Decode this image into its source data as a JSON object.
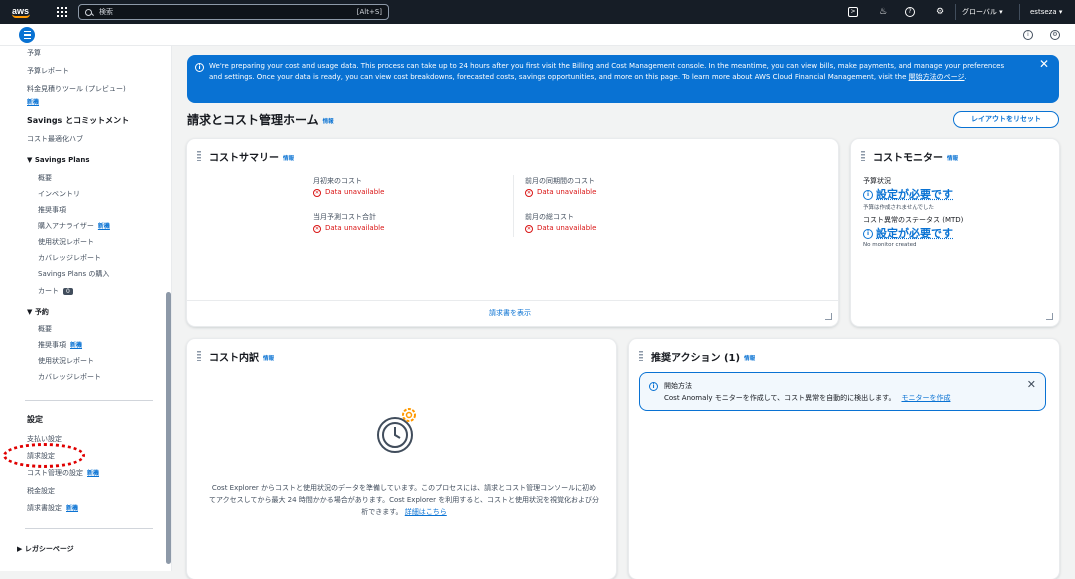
{
  "topbar": {
    "logo": "aws",
    "search_placeholder": "検索",
    "search_shortcut": "[Alt+S]",
    "region": "グローバル ▾",
    "account": "estseza ▾"
  },
  "sidebar": {
    "items": [
      {
        "label": "予算",
        "badge": ""
      },
      {
        "label": "予算レポート",
        "badge": ""
      },
      {
        "label": "料金見積りツール (プレビュー)",
        "badge": ""
      },
      {
        "label": "",
        "badge": "新機"
      },
      {
        "label": "Savings とコミットメント",
        "badge": ""
      },
      {
        "label": "コスト最適化ハブ",
        "badge": ""
      },
      {
        "label": "▼ Savings Plans",
        "badge": ""
      },
      {
        "label": "概要",
        "badge": ""
      },
      {
        "label": "インベントリ",
        "badge": ""
      },
      {
        "label": "推奨事項",
        "badge": ""
      },
      {
        "label": "購入アナライザー",
        "badge": "新機"
      },
      {
        "label": "使用状況レポート",
        "badge": ""
      },
      {
        "label": "カバレッジレポート",
        "badge": ""
      },
      {
        "label": "Savings Plans の購入",
        "badge": ""
      },
      {
        "label": "カート",
        "badge": "0"
      },
      {
        "label": "▼ 予約",
        "badge": ""
      },
      {
        "label": "概要",
        "badge": ""
      },
      {
        "label": "推奨事項",
        "badge": "新機"
      },
      {
        "label": "使用状況レポート",
        "badge": ""
      },
      {
        "label": "カバレッジレポート",
        "badge": ""
      },
      {
        "label": "設定",
        "badge": ""
      },
      {
        "label": "支払い設定",
        "badge": ""
      },
      {
        "label": "請求設定",
        "badge": ""
      },
      {
        "label": "コスト管理の設定",
        "badge": "新機"
      },
      {
        "label": "税金設定",
        "badge": ""
      },
      {
        "label": "請求書設定",
        "badge": "新機"
      },
      {
        "label": "▶ レガシーページ",
        "badge": ""
      }
    ]
  },
  "flash": {
    "message": "We're preparing your cost and usage data. This process can take up to 24 hours after you first visit the Billing and Cost Management console. In the meantime, you can view bills, make payments, and manage your preferences and settings. Once your data is ready, you can view cost breakdowns, forecasted costs, savings opportunities, and more on this page. To learn more about AWS Cloud Financial Management, visit the ",
    "link": "開始方法のページ",
    "link_suffix": "."
  },
  "page": {
    "title": "請求とコスト管理ホーム",
    "info": "情報",
    "reset_button": "レイアウトをリセット"
  },
  "cost_summary": {
    "title": "コストサマリー",
    "info": "情報",
    "metrics": [
      {
        "label": "月初来のコスト",
        "value": "Data unavailable"
      },
      {
        "label": "前月の同期間のコスト",
        "value": "Data unavailable"
      },
      {
        "label": "当月予測コスト合計",
        "value": "Data unavailable"
      },
      {
        "label": "前月の総コスト",
        "value": "Data unavailable"
      }
    ],
    "footer_link": "請求書を表示"
  },
  "cost_monitor": {
    "title": "コストモニター",
    "info": "情報",
    "budget_label": "予算状況",
    "budget_value": "設定が必要です",
    "budget_sub": "予算は作成されませんでした",
    "anomaly_label": "コスト異常のステータス (MTD)",
    "anomaly_value": "設定が必要です",
    "anomaly_sub": "No monitor created"
  },
  "cost_breakdown": {
    "title": "コスト内訳",
    "info": "情報",
    "message": "Cost Explorer からコストと使用状況のデータを準備しています。このプロセスには、請求とコスト管理コンソールに初めてアクセスしてから最大 24 時間かかる場合があります。Cost Explorer を利用すると、コストと使用状況を視覚化および分析できます。",
    "link": "詳細はこちら"
  },
  "recommended_actions": {
    "title": "推奨アクション (1)",
    "info": "情報",
    "alert_title": "開始方法",
    "alert_body": "Cost Anomaly モニターを作成して、コスト異常を自動的に検出します。",
    "alert_link": "モニターを作成"
  }
}
